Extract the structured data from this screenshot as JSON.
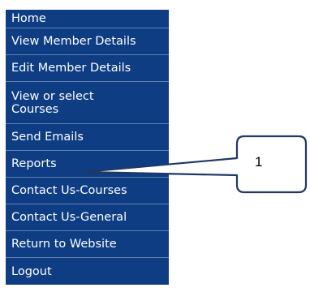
{
  "nav": {
    "items": [
      {
        "label": "Home"
      },
      {
        "label": "View Member Details"
      },
      {
        "label": "Edit Member Details"
      },
      {
        "label": "View or select\nCourses"
      },
      {
        "label": "Send Emails"
      },
      {
        "label": "Reports"
      },
      {
        "label": "Contact Us-Courses"
      },
      {
        "label": "Contact Us-General"
      },
      {
        "label": "Return to Website"
      },
      {
        "label": "Logout"
      }
    ]
  },
  "callout": {
    "number": "1",
    "border_color": "#1f3864",
    "fill_color": "#ffffff"
  },
  "colors": {
    "nav_bg": "#0e3d84",
    "nav_divider": "#5f7fb0",
    "nav_text": "#ffffff"
  }
}
